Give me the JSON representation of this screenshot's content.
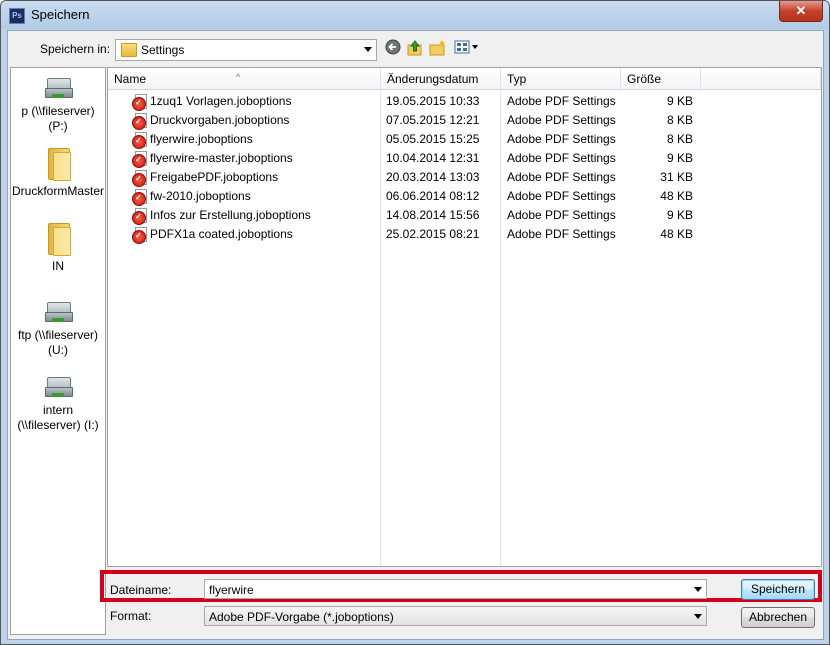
{
  "window": {
    "title": "Speichern",
    "app_icon": "Ps",
    "close_label": "✕"
  },
  "location": {
    "label": "Speichern in:",
    "current_folder": "Settings"
  },
  "toolbar": {
    "icons": [
      "back-icon",
      "up-folder-icon",
      "new-folder-icon",
      "view-menu-icon"
    ]
  },
  "places": [
    {
      "label": "p (\\\\fileserver)\n(P:)",
      "icon": "network-drive-icon"
    },
    {
      "label": "DruckformMaster",
      "icon": "folder-icon"
    },
    {
      "label": "IN",
      "icon": "folder-icon"
    },
    {
      "label": "ftp (\\\\fileserver)\n(U:)",
      "icon": "network-drive-icon"
    },
    {
      "label": "intern\n(\\\\fileserver) (I:)",
      "icon": "network-drive-icon"
    }
  ],
  "columns": {
    "name": "Name",
    "date": "Änderungsdatum",
    "type": "Typ",
    "size": "Größe"
  },
  "files": [
    {
      "name": "1zuq1 Vorlagen.joboptions",
      "date": "19.05.2015 10:33",
      "type": "Adobe PDF Settings",
      "size": "9 KB"
    },
    {
      "name": "Druckvorgaben.joboptions",
      "date": "07.05.2015 12:21",
      "type": "Adobe PDF Settings",
      "size": "8 KB"
    },
    {
      "name": "flyerwire.joboptions",
      "date": "05.05.2015 15:25",
      "type": "Adobe PDF Settings",
      "size": "8 KB"
    },
    {
      "name": "flyerwire-master.joboptions",
      "date": "10.04.2014 12:31",
      "type": "Adobe PDF Settings",
      "size": "9 KB"
    },
    {
      "name": "FreigabePDF.joboptions",
      "date": "20.03.2014 13:03",
      "type": "Adobe PDF Settings",
      "size": "31 KB"
    },
    {
      "name": "fw-2010.joboptions",
      "date": "06.06.2014 08:12",
      "type": "Adobe PDF Settings",
      "size": "48 KB"
    },
    {
      "name": "Infos zur Erstellung.joboptions",
      "date": "14.08.2014 15:56",
      "type": "Adobe PDF Settings",
      "size": "9 KB"
    },
    {
      "name": "PDFX1a coated.joboptions",
      "date": "25.02.2015 08:21",
      "type": "Adobe PDF Settings",
      "size": "48 KB"
    }
  ],
  "filename": {
    "label": "Dateiname:",
    "value": "flyerwire"
  },
  "format": {
    "label": "Format:",
    "value": "Adobe PDF-Vorgabe (*.joboptions)"
  },
  "buttons": {
    "save": "Speichern",
    "cancel": "Abbrechen"
  },
  "colors": {
    "highlight_frame": "#d4001b",
    "titlebar": "#bcd3ea",
    "close_button": "#c2412a"
  }
}
